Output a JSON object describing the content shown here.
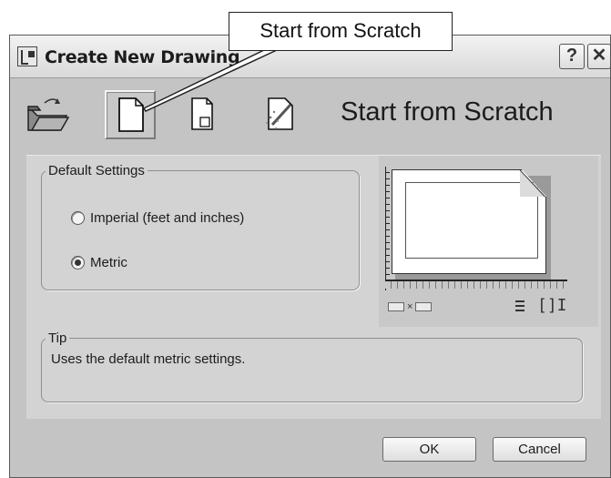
{
  "window": {
    "title": "Create New Drawing",
    "help_label": "?",
    "close_label": "✕"
  },
  "callout": {
    "text": "Start from Scratch"
  },
  "toolbar": {
    "heading": "Start from Scratch",
    "tools": [
      {
        "name": "open-folder-icon",
        "active": false
      },
      {
        "name": "blank-page-icon",
        "active": true
      },
      {
        "name": "template-icon",
        "active": false
      },
      {
        "name": "wizard-icon",
        "active": false
      }
    ]
  },
  "default_settings": {
    "legend": "Default Settings",
    "options": [
      {
        "label": "Imperial (feet and inches)",
        "selected": false
      },
      {
        "label": "Metric",
        "selected": true
      }
    ]
  },
  "preview": {
    "dims_separator": "×"
  },
  "tip": {
    "legend": "Tip",
    "text": "Uses the default metric settings."
  },
  "buttons": {
    "ok": "OK",
    "cancel": "Cancel"
  }
}
